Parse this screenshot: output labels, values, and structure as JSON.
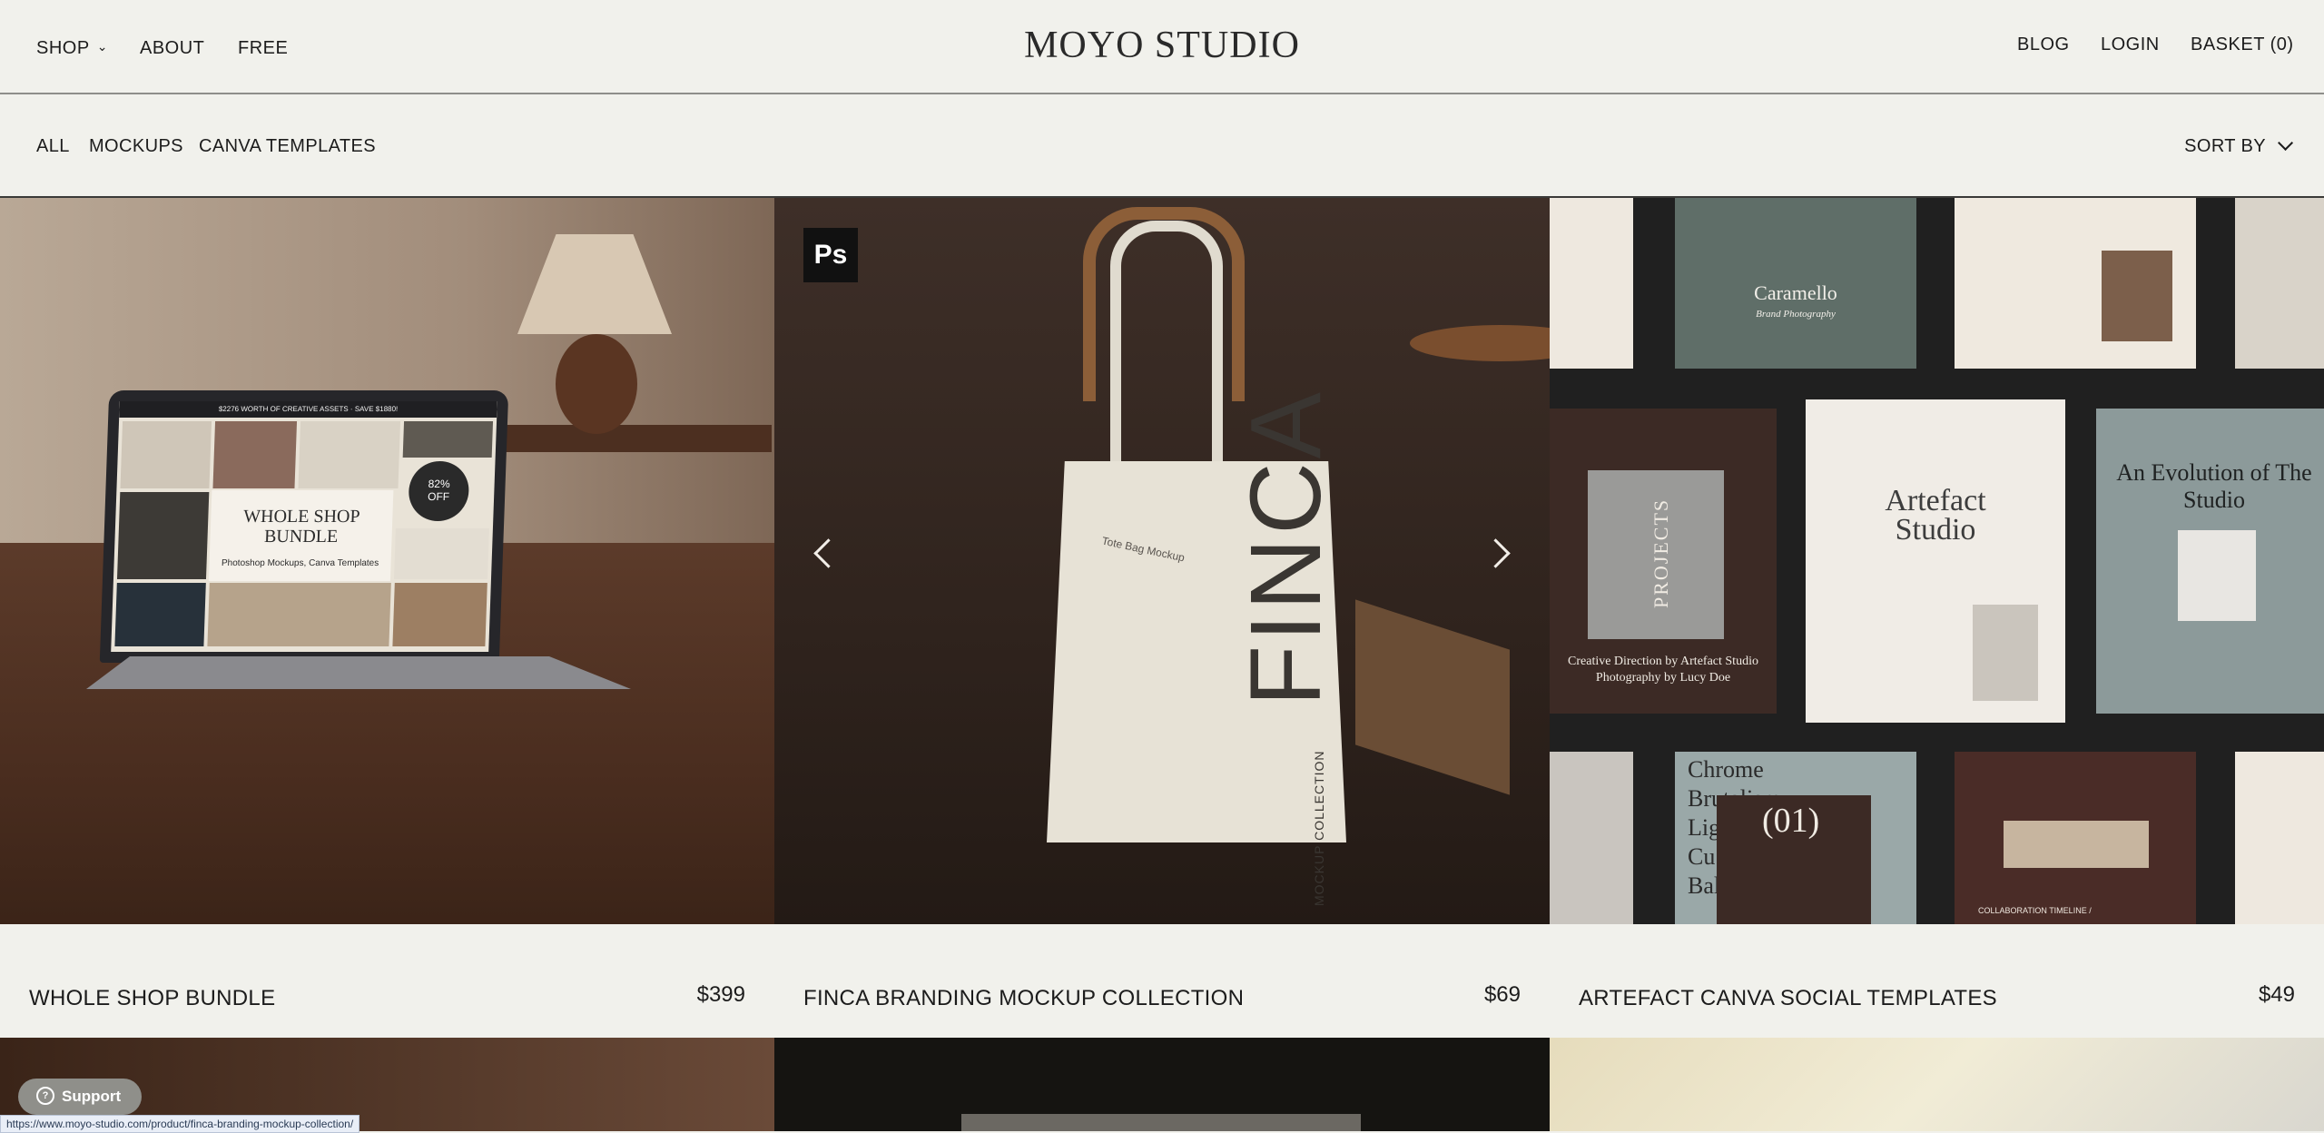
{
  "header": {
    "nav_left": [
      "SHOP",
      "ABOUT",
      "FREE"
    ],
    "logo": "MOYO STUDIO",
    "nav_right": [
      "BLOG",
      "LOGIN",
      "BASKET (0)"
    ]
  },
  "filters": {
    "items": [
      "ALL",
      "MOCKUPS",
      "CANVA TEMPLATES"
    ],
    "active": "ALL",
    "sort_label": "SORT BY"
  },
  "products": [
    {
      "name": "WHOLE SHOP BUNDLE",
      "price": "$399",
      "image_text": {
        "banner": "$2276 WORTH OF CREATIVE ASSETS · SAVE $1880!",
        "title_line1": "WHOLE SHOP",
        "title_line2": "BUNDLE",
        "subtitle": "Photoshop Mockups, Canva Templates",
        "badge_pct": "82%",
        "badge_word": "OFF"
      }
    },
    {
      "name": "FINCA BRANDING MOCKUP COLLECTION",
      "price": "$69",
      "image_text": {
        "ps_badge": "Ps",
        "bag_label": "Tote Bag Mockup",
        "bag_brand": "FINCA",
        "bag_sub": "MOCKUP COLLECTION"
      }
    },
    {
      "name": "ARTEFACT CANVA SOCIAL TEMPLATES",
      "price": "$49",
      "image_text": {
        "caramello": "Caramello",
        "brand_photo": "Brand Photography",
        "projects": "PROJECTS",
        "artefact": "Artefact Studio",
        "evolution": "An Evolution of The Studio",
        "creative": "Creative Direction by Artefact Studio Photography by Lucy Doe",
        "chrome": "Chrome Brutalism Light Cu Ma Bal",
        "num": "(01)",
        "collab": "COLLABORATION TIMELINE /"
      }
    }
  ],
  "support_label": "Support",
  "status_url": "https://www.moyo-studio.com/product/finca-branding-mockup-collection/"
}
